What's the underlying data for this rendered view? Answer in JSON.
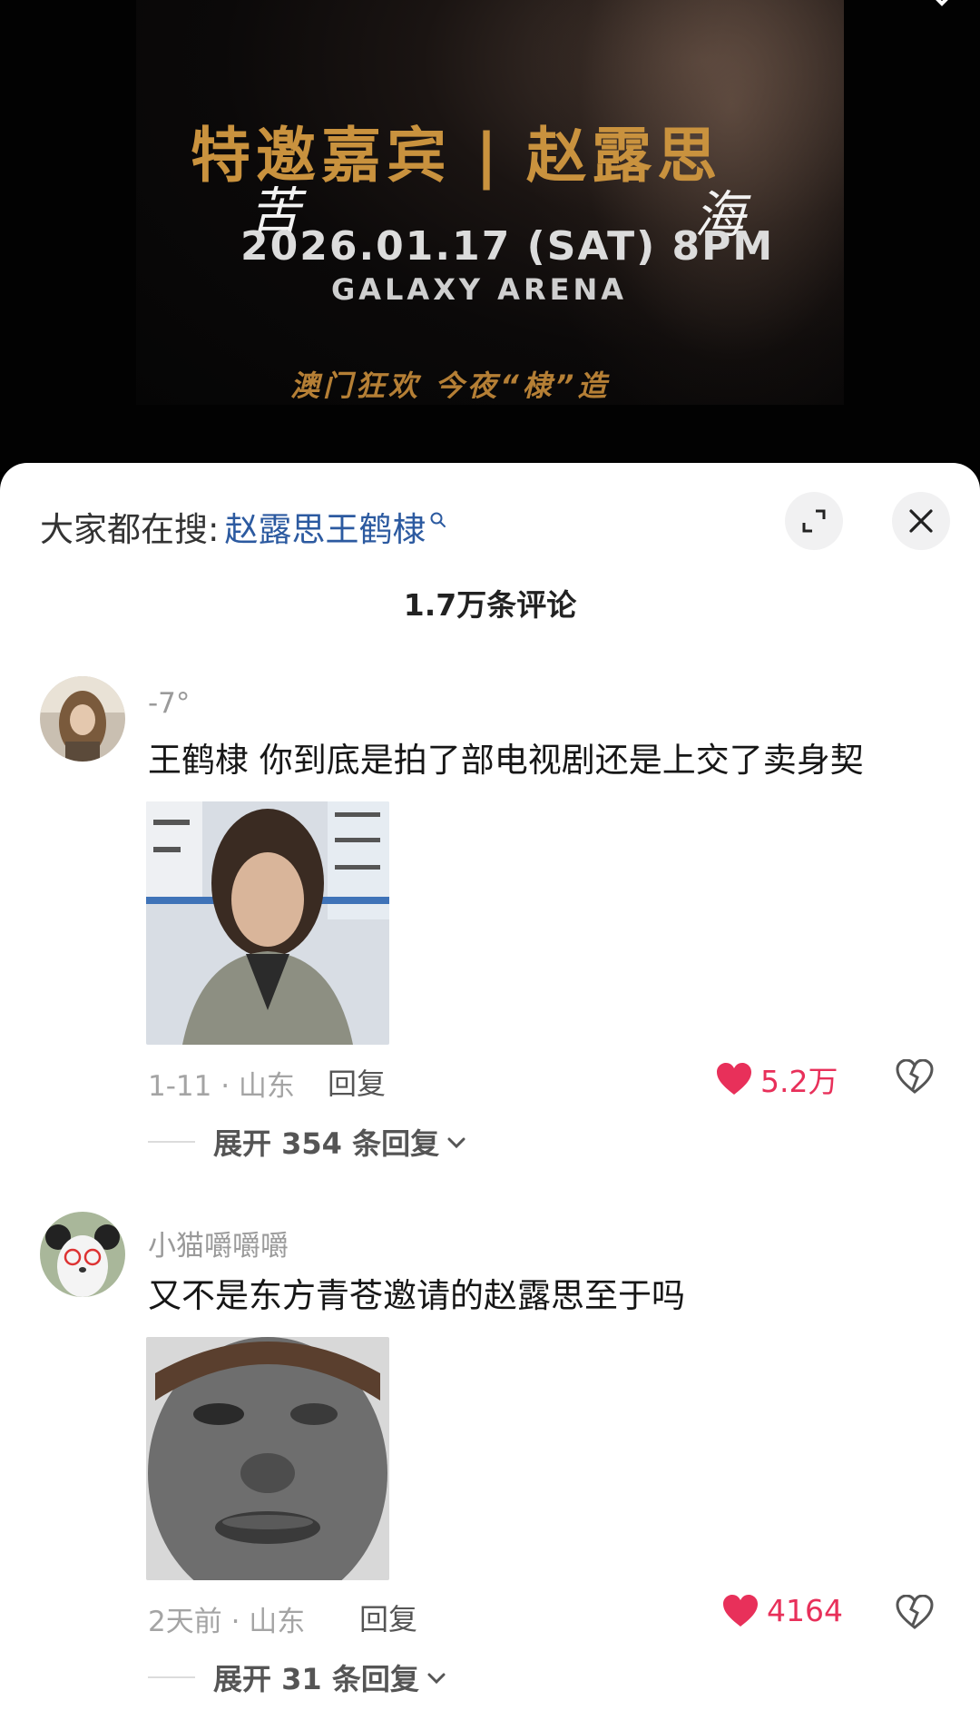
{
  "poster": {
    "title_left": "特邀嘉宾",
    "title_sep": "|",
    "title_right": "赵露思",
    "kuhai_left": "苦",
    "kuhai_right": "海",
    "date": "2026.01.17 (SAT) 8PM",
    "venue": "GALAXY ARENA",
    "slogan": "澳门狂欢  今夜“棣”造"
  },
  "search": {
    "prefix": "大家都在搜:",
    "query": "赵露思王鹤棣"
  },
  "comments_header": {
    "count_label": "1.7万条评论"
  },
  "comments": [
    {
      "username": "-7°",
      "text": "王鹤棣 你到底是拍了部电视剧还是上交了卖身契",
      "time_location": "1-11 · 山东",
      "reply_label": "回复",
      "likes": "5.2万",
      "expand_label": "展开 354 条回复"
    },
    {
      "username": "小猫嚼嚼嚼",
      "text": "又不是东方青苍邀请的赵露思至于吗",
      "time_location": "2天前 · 山东",
      "reply_label": "回复",
      "likes": "4164",
      "expand_label": "展开 31 条回复"
    }
  ],
  "colors": {
    "like_red": "#e8305a",
    "link_blue": "#2c5aa0",
    "poster_gold": "#c9923e"
  },
  "icons": [
    "expand-icon",
    "close-icon",
    "search-icon",
    "heart-icon",
    "broken-heart-icon",
    "chevron-down-icon"
  ]
}
